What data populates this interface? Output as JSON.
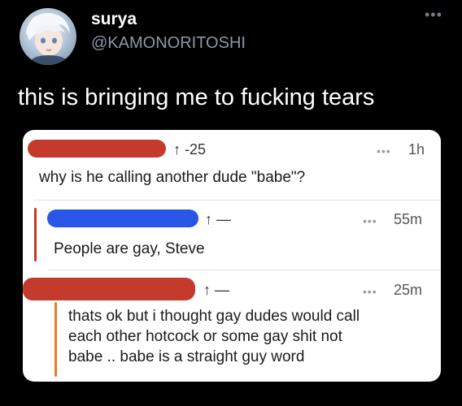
{
  "tweet": {
    "display_name": "surya",
    "handle": "@KAMONORITOSHI",
    "text": "this is bringing me to fucking tears",
    "more_menu": "•••"
  },
  "comments": [
    {
      "score": "↑ -25",
      "time": "1h",
      "dots": "•••",
      "text": "why is he calling another dude \"babe\"?",
      "redaction_color": "#c43a2c"
    },
    {
      "score": "↑ —",
      "time": "55m",
      "dots": "•••",
      "text": "People are gay, Steve",
      "redaction_color": "#2956e6",
      "thread_color": "#c0392b"
    },
    {
      "score": "↑ —",
      "time": "25m",
      "dots": "•••",
      "text_lines": [
        "thats ok but i thought gay dudes would call",
        "each other hotcock or some gay shit not",
        "babe .. babe is a straight guy word"
      ],
      "redaction_color": "#c43a2c",
      "thread_color": "#e67e22"
    }
  ],
  "colors": {
    "background": "#000000",
    "card": "#ffffff",
    "handle": "#8b98a5"
  }
}
